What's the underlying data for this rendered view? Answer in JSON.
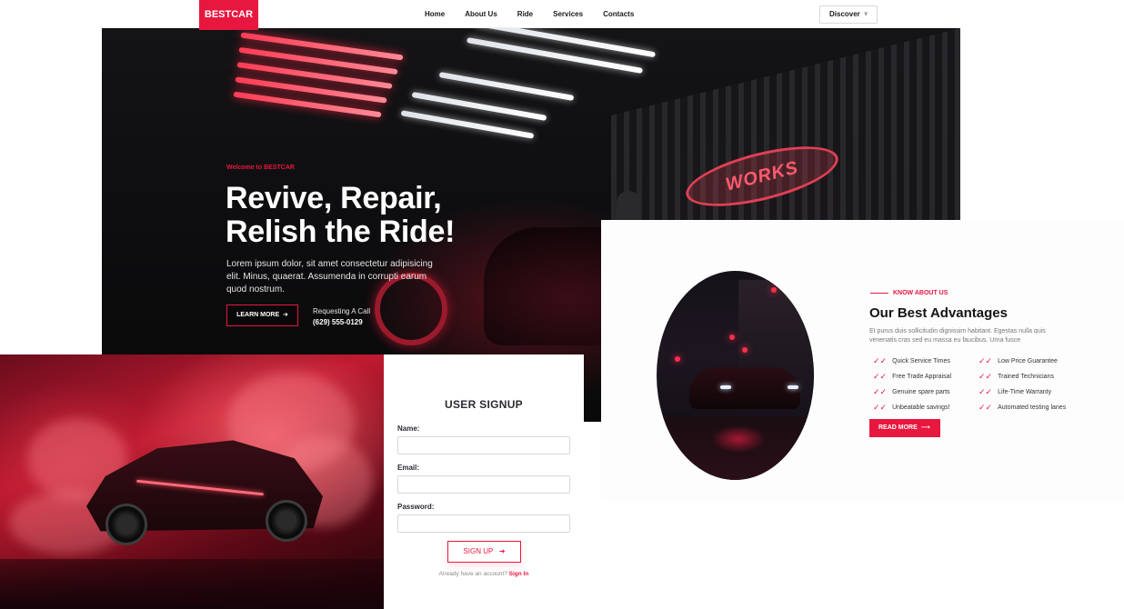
{
  "nav": {
    "logo": "BESTCAR",
    "items": [
      {
        "label": "Home"
      },
      {
        "label": "About Us"
      },
      {
        "label": "Ride"
      },
      {
        "label": "Services"
      },
      {
        "label": "Contacts"
      }
    ],
    "discover_label": "Discover"
  },
  "hero": {
    "kicker": "Welcome to BESTCAR",
    "title_line1": "Revive, Repair,",
    "title_line2": "Relish the Ride!",
    "description": "Lorem ipsum dolor, sit amet consectetur adipisicing elit. Minus, quaerat. Assumenda in corrupti earum quod nostrum.",
    "learn_more": "LEARN MORE",
    "call_label": "Requesting A Call",
    "call_number": "(629) 555-0129",
    "badge_text": "WORKS"
  },
  "about": {
    "kicker": "KNOW ABOUT US",
    "title": "Our Best Advantages",
    "description": "Et purus duis sollicitudin dignissim habitant. Egestas nulla quis venenatis cras sed eu massa eu faucibus. Urna fusce",
    "advantages_left": [
      "Quick Service Times",
      "Free Trade Appraisal",
      "Genuine spare parts",
      "Unbeatable savings!"
    ],
    "advantages_right": [
      "Low Price Guarantee",
      "Trained Technicians",
      "Life-Time Warranty",
      "Automated testing lanes"
    ],
    "read_more": "READ MORE"
  },
  "signup": {
    "title": "USER SIGNUP",
    "name_label": "Name:",
    "email_label": "Email:",
    "password_label": "Password:",
    "button": "SIGN UP",
    "have_account": "Already have an account?",
    "sign_in": "Sign In"
  },
  "colors": {
    "accent": "#e8173f",
    "dark": "#141414"
  }
}
